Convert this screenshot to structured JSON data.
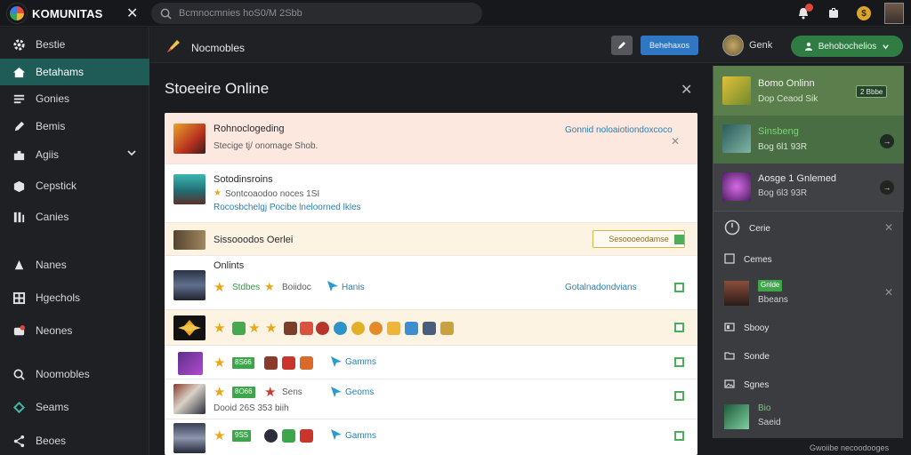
{
  "app": {
    "name": "KOMUNITAS",
    "search_placeholder": "Bcmnocmnies hoS0/M 2Sbb"
  },
  "sidebar": {
    "items": [
      {
        "label": "Bestie",
        "icon": "gear-icon"
      },
      {
        "label": "Betahams",
        "icon": "home-icon"
      },
      {
        "label": "Gonies",
        "icon": "list-icon"
      },
      {
        "label": "Bemis",
        "icon": "pencil-icon"
      },
      {
        "label": "Agiis",
        "icon": "puzzle-icon"
      },
      {
        "label": "Cepstick",
        "icon": "box-icon"
      },
      {
        "label": "Canies",
        "icon": "grid-icon"
      },
      {
        "label": "Nanes",
        "icon": "person-icon"
      },
      {
        "label": "Hgechols",
        "icon": "table-icon"
      },
      {
        "label": "Neones",
        "icon": "chat-icon"
      },
      {
        "label": "Noomobles",
        "icon": "search-icon"
      },
      {
        "label": "Seams",
        "icon": "star-icon"
      },
      {
        "label": "Beoes",
        "icon": "share-icon"
      }
    ]
  },
  "subheader": {
    "title": "Nocmobles",
    "blue_button": "Behehaxos",
    "user_name": "Genk",
    "green_button": "Behobochelios"
  },
  "main": {
    "title": "Stoeeire Online",
    "rows": [
      {
        "title": "Rohnoclogeding",
        "sub": "Stecige tj/ onomage Shob.",
        "link": "Gonnid noloaiotiondoxcoco"
      },
      {
        "title": "Sotodinsroins",
        "sub": "Sontcoaodoo noces 1SI",
        "link": "Rocosbchelgj Pocibe lneloorned lkles"
      },
      {
        "title": "Sissooodos Oerlei",
        "button": "Sesoooeodamse"
      },
      {
        "title": "Onlints",
        "rank": "Stdbes",
        "tag": "Boiidoc",
        "link2": "Hanis",
        "link": "Gotalnadondvians"
      },
      {
        "title": ""
      },
      {
        "badge": "8S66",
        "link": "Gamms"
      },
      {
        "badge": "8O66",
        "link": "Geoms",
        "tag": "Sens",
        "sub": "Dooid 26S 353 biih"
      },
      {
        "badge": "9SS",
        "link": "Gamms"
      }
    ]
  },
  "rpanel": {
    "card1_title": "Bomo Onlinn",
    "card1_sub": "Dop Ceaod Sik",
    "card1_btn": "2 Bbbe",
    "card2_title": "Sinsbeng",
    "card2_sub": "Bog 6l1 93R",
    "card3_title": "Aosge 1 Gnlemed",
    "card3_sub": "Bog 6l3 93R",
    "items": [
      "Cerie",
      "Cemes",
      "Sbooy",
      "Sonde",
      "Sgnes"
    ],
    "user_badge": "Gnlde",
    "user_sub": "Bbeans",
    "bottom_badge": "Bio",
    "bottom_sub": "Saeid",
    "footer": "Gwoiibe necoodooges"
  },
  "colors": {
    "accent": "#1f5c57",
    "green": "#3da64a",
    "blue": "#2f77c2"
  }
}
